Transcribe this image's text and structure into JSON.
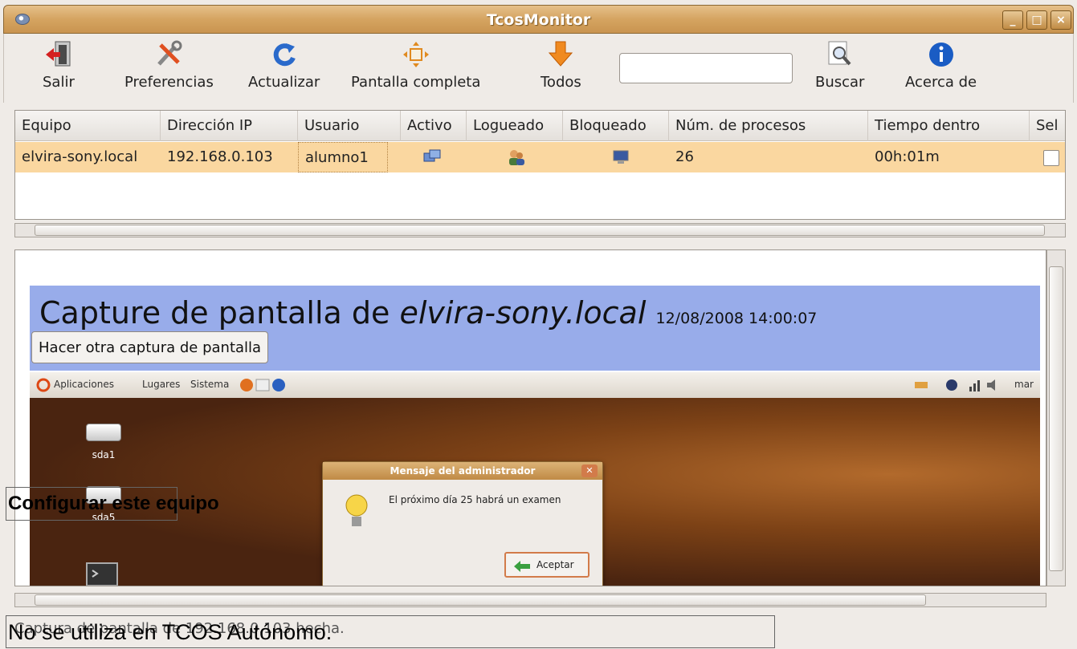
{
  "window": {
    "title": "TcosMonitor",
    "controls": [
      "_",
      "□",
      "×"
    ]
  },
  "toolbar": {
    "items": [
      {
        "label": "Salir",
        "icon": "exit-icon"
      },
      {
        "label": "Preferencias",
        "icon": "tools-icon"
      },
      {
        "label": "Actualizar",
        "icon": "refresh-icon"
      },
      {
        "label": "Pantalla completa",
        "icon": "fullscreen-icon"
      },
      {
        "label": "Todos",
        "icon": "arrow-down-icon"
      },
      {
        "label": "Buscar",
        "icon": "search-icon"
      },
      {
        "label": "Acerca de",
        "icon": "info-icon"
      }
    ],
    "search_value": ""
  },
  "table": {
    "columns": [
      "Equipo",
      "Dirección IP",
      "Usuario",
      "Activo",
      "Logueado",
      "Bloqueado",
      "Núm. de procesos",
      "Tiempo dentro",
      "Sel"
    ],
    "rows": [
      {
        "host": "elvira-sony.local",
        "ip": "192.168.0.103",
        "user": "alumno1",
        "processes": "26",
        "time": "00h:01m",
        "selected": false
      }
    ],
    "row_color": "#fad7a0"
  },
  "screenshot": {
    "heading_prefix": "Capture de pantalla de",
    "heading_host": "elvira-sony.local",
    "timestamp": "12/08/2008 14:00:07",
    "retake_button": "Hacer otra captura de pantalla",
    "panel_menus": [
      "Aplicaciones",
      "Lugares",
      "Sistema"
    ],
    "panel_clock": "mar",
    "desktop_icons": [
      "sda1",
      "sda5"
    ],
    "dialog": {
      "title": "Mensaje del administrador",
      "message": "El próximo día 25 habrá un examen",
      "button": "Aceptar"
    },
    "banner_color": "#98acea"
  },
  "overlays": {
    "config": "Configurar este equipo",
    "tcos": "No se utiliza en TCOS Autónomo."
  },
  "statusbar": {
    "text": "Captura de pantalla de 192.168.0.103 hecha."
  }
}
